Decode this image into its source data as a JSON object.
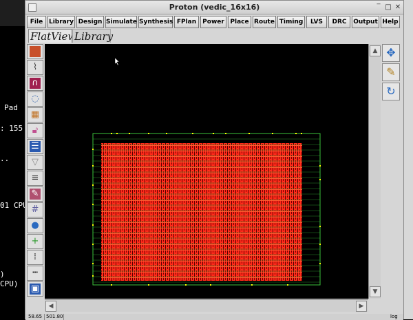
{
  "terminal": {
    "lines": [
      "Pad",
      ": 155",
      "..",
      "01 CPU",
      ")",
      "CPU)"
    ]
  },
  "window": {
    "title": "Proton (vedic_16x16)"
  },
  "menu": {
    "items": [
      "File",
      "Library",
      "Design",
      "Simulate",
      "Synthesis",
      "FPlan",
      "Power",
      "Place",
      "Route",
      "Timing",
      "LVS",
      "DRC",
      "Output",
      "Help"
    ]
  },
  "tabs": {
    "items": [
      "FlatView",
      "Library"
    ],
    "active": "FlatView"
  },
  "left_toolbar": {
    "icons": [
      "brick-wall-icon",
      "route-icon",
      "magnet-icon",
      "lasso-icon",
      "cells-icon",
      "lock-icon",
      "list-icon",
      "filter-icon",
      "rows-icon",
      "eraser-icon",
      "grid-icon",
      "globe-icon",
      "add-cell-icon",
      "dots-icon",
      "ruler-icon",
      "save-icon"
    ]
  },
  "right_toolbar": {
    "icons": [
      "pan-icon",
      "pencil-icon",
      "refresh-icon"
    ]
  },
  "layout": {
    "core_color": "#ff2a1a",
    "boundary_color": "#3cc43c",
    "pin_color": "#ffff00"
  },
  "status": {
    "cells": [
      "58.65",
      "501.80"
    ],
    "right_label": "log"
  }
}
